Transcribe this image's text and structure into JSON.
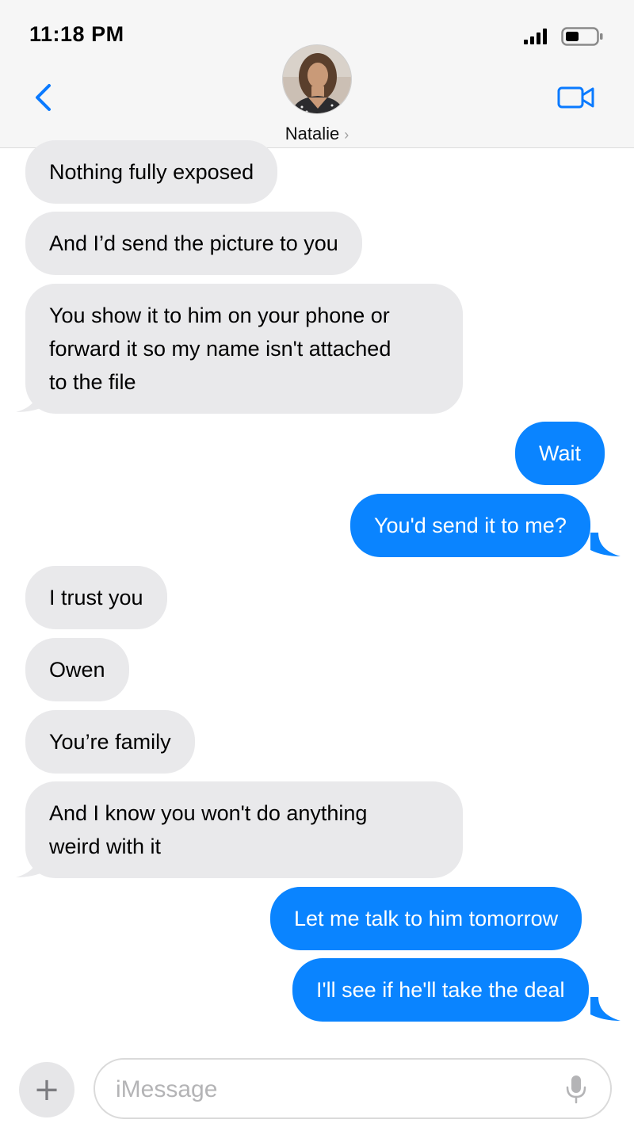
{
  "status_bar": {
    "time": "11:18 PM"
  },
  "header": {
    "contact_name": "Natalie",
    "chevron": "›"
  },
  "messages": [
    {
      "side": "in",
      "text": "Nothing fully exposed"
    },
    {
      "side": "in",
      "text": "And I’d send the picture to you"
    },
    {
      "side": "in",
      "lines": [
        "You show it to him on your phone or",
        "forward it so my name isn't attached",
        "to the file"
      ]
    },
    {
      "side": "out",
      "text": "Wait"
    },
    {
      "side": "out",
      "text": "You'd send it to me?"
    },
    {
      "side": "in",
      "text": "I trust you"
    },
    {
      "side": "in",
      "text": "Owen"
    },
    {
      "side": "in",
      "text": "You’re family"
    },
    {
      "side": "in",
      "lines": [
        "And I know you won't do anything",
        "weird with it"
      ]
    },
    {
      "side": "out",
      "text": "Let me talk to him tomorrow"
    },
    {
      "side": "out",
      "text": "I'll see if he'll take the deal"
    }
  ],
  "composer": {
    "placeholder": "iMessage",
    "plus_label": "+"
  },
  "colors": {
    "incoming": "#e9e9eb",
    "outgoing": "#0a84ff",
    "accent": "#0a7aff"
  },
  "icons": {
    "back": "chevron-left-icon",
    "video": "video-camera-icon",
    "mic": "microphone-icon",
    "signal": "cellular-signal-icon",
    "battery": "battery-icon"
  }
}
